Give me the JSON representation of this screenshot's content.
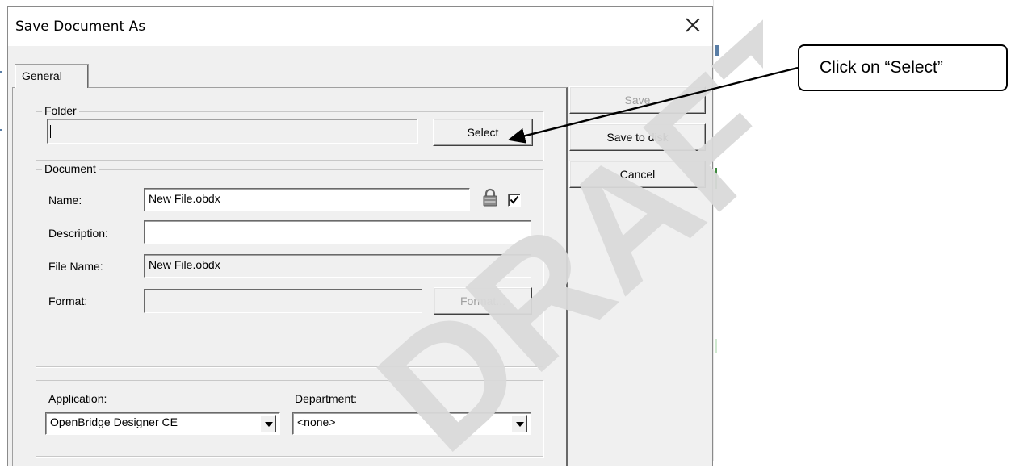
{
  "dialog": {
    "title": "Save Document As"
  },
  "tabs": [
    {
      "label": "General"
    }
  ],
  "folder_group": {
    "title": "Folder",
    "path_value": "",
    "select_label": "Select"
  },
  "document_group": {
    "title": "Document",
    "name_label": "Name:",
    "name_value": "New File.obdx",
    "name_checked": true,
    "description_label": "Description:",
    "description_value": "",
    "filename_label": "File Name:",
    "filename_value": "New File.obdx",
    "format_label": "Format:",
    "format_value": "",
    "format_button": "Format..."
  },
  "app_group": {
    "application_label": "Application:",
    "application_value": "OpenBridge Designer CE",
    "department_label": "Department:",
    "department_value": "<none>"
  },
  "actions": {
    "save": "Save",
    "save_to_disk": "Save to disk",
    "cancel": "Cancel"
  },
  "watermark": "DRAFT",
  "callout": {
    "text": "Click on “Select”"
  },
  "colors": {
    "dialog_bg": "#f0f0f0",
    "watermark": "#d9d9d9",
    "disabled_text": "#a0a0a0"
  }
}
